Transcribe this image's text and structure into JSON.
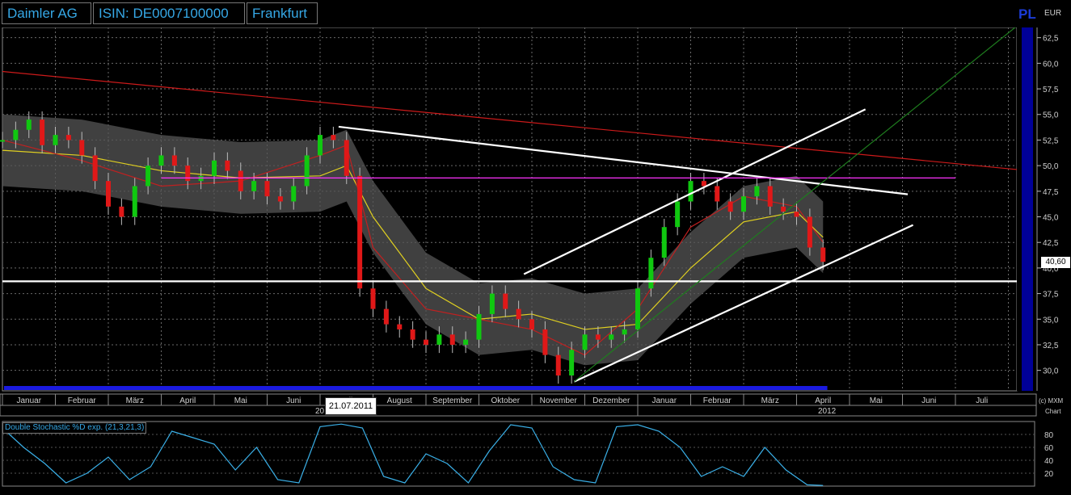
{
  "header": {
    "name": "Daimler AG",
    "isin": "ISIN: DE0007100000",
    "exchange": "Frankfurt",
    "pl_marker": "PL",
    "currency": "EUR"
  },
  "chart_data": [
    {
      "type": "line",
      "title": "Daimler AG",
      "x_months": [
        "Januar",
        "Februar",
        "März",
        "April",
        "Mai",
        "Juni",
        "Juli",
        "August",
        "September",
        "Oktober",
        "November",
        "Dezember",
        "Januar",
        "Februar",
        "März",
        "April",
        "Mai",
        "Juni",
        "Juli"
      ],
      "x_years": [
        "2011",
        "2012"
      ],
      "y_ticks": [
        30.0,
        32.5,
        35.0,
        37.5,
        40.0,
        42.5,
        45.0,
        47.5,
        50.0,
        52.5,
        55.0,
        57.5,
        60.0,
        62.5
      ],
      "ylim": [
        28.0,
        63.5
      ],
      "grid": true,
      "last_price": "40,60",
      "crosshair_date": "21.07.2011",
      "series": [
        {
          "type": "candlestick",
          "x": [
            0,
            0.25,
            0.5,
            0.75,
            1,
            1.25,
            1.5,
            1.75,
            2,
            2.25,
            2.5,
            2.75,
            3,
            3.25,
            3.5,
            3.75,
            4,
            4.25,
            4.5,
            4.75,
            5,
            5.25,
            5.5,
            5.75,
            6,
            6.25,
            6.5,
            6.75,
            7,
            7.25,
            7.5,
            7.75,
            8,
            8.25,
            8.5,
            8.75,
            9,
            9.25,
            9.5,
            9.75,
            10,
            10.25,
            10.5,
            10.75,
            11,
            11.25,
            11.5,
            11.75,
            12,
            12.25,
            12.5,
            12.75,
            13,
            13.25,
            13.5,
            13.75,
            14,
            14.25,
            14.5,
            14.75,
            15,
            15.25,
            15.5
          ],
          "close": [
            52.5,
            53.5,
            54.5,
            52,
            53,
            52.5,
            51,
            48.5,
            46,
            45,
            48,
            50,
            51,
            50,
            48.5,
            49,
            50.5,
            49.5,
            47.5,
            48.5,
            47,
            46.5,
            48,
            51,
            53,
            52.5,
            49,
            38,
            36,
            34.5,
            34,
            33,
            32.5,
            33.5,
            32.5,
            33,
            35.5,
            37.5,
            36,
            35,
            34,
            31.5,
            29.5,
            32,
            33.5,
            33,
            33.5,
            34,
            38,
            41,
            44,
            46.5,
            48.5,
            48,
            46.5,
            45.5,
            47,
            48,
            46,
            45.5,
            45,
            42,
            40.6
          ]
        },
        {
          "name": "",
          "x": [
            0,
            1.5,
            3,
            4.5,
            6,
            6.5,
            7,
            8,
            9,
            10,
            11,
            12,
            13,
            14,
            15,
            15.5
          ],
          "values": [
            51.5,
            51,
            49.5,
            48.8,
            49,
            50,
            45,
            38,
            35,
            35.5,
            34,
            34.5,
            40,
            44.5,
            45.5,
            43
          ]
        },
        {
          "name": "",
          "x": [
            0,
            1.5,
            3,
            4.5,
            6,
            6.5,
            7,
            8,
            9,
            10,
            11,
            12,
            13,
            14,
            15,
            15.5
          ],
          "values": [
            52.5,
            50.5,
            48,
            48.5,
            51,
            52,
            42,
            36,
            35,
            34,
            31.5,
            36,
            44,
            47,
            46,
            42.5
          ]
        }
      ],
      "lines": [
        {
          "name": "",
          "color": "#cc1a1a",
          "from": [
            0,
            59.2
          ],
          "to": [
            19.2,
            49.6
          ]
        },
        {
          "name": "",
          "color": "#ffffff",
          "from": [
            6.35,
            53.8
          ],
          "to": [
            17.1,
            47.2
          ]
        },
        {
          "name": "",
          "color": "#ffffff",
          "from": [
            9.85,
            39.4
          ],
          "to": [
            16.3,
            55.5
          ]
        },
        {
          "name": "",
          "color": "#ffffff",
          "from": [
            10.8,
            28.9
          ],
          "to": [
            17.2,
            44.2
          ]
        },
        {
          "name": "",
          "color": "#ff33ff",
          "from": [
            3.0,
            48.8
          ],
          "to": [
            18.0,
            48.8
          ]
        },
        {
          "name": "",
          "color": "#ffffff",
          "from": [
            0,
            38.7
          ],
          "to": [
            19.4,
            38.7
          ]
        },
        {
          "name": "",
          "color": "#1e7d1e",
          "from": [
            10.8,
            28.9
          ],
          "to": [
            19.2,
            63.8
          ]
        }
      ]
    },
    {
      "type": "line",
      "title": "Double Stochastic %D exp. (21,3,21,3)",
      "y_ticks": [
        20,
        40,
        60,
        80
      ],
      "ylim": [
        0,
        100
      ],
      "series": [
        {
          "name": "",
          "x": [
            0,
            0.4,
            0.8,
            1.2,
            1.6,
            2,
            2.4,
            2.8,
            3.2,
            3.6,
            4,
            4.4,
            4.8,
            5.2,
            5.6,
            6,
            6.4,
            6.8,
            7.2,
            7.6,
            8,
            8.4,
            8.8,
            9.2,
            9.6,
            10,
            10.4,
            10.8,
            11.2,
            11.6,
            12,
            12.4,
            12.8,
            13.2,
            13.6,
            14,
            14.4,
            14.8,
            15.2,
            15.5
          ],
          "values": [
            90,
            60,
            35,
            5,
            20,
            45,
            10,
            30,
            85,
            75,
            65,
            25,
            60,
            10,
            5,
            92,
            96,
            90,
            15,
            5,
            50,
            35,
            5,
            55,
            95,
            90,
            30,
            10,
            5,
            92,
            95,
            85,
            60,
            15,
            30,
            15,
            60,
            25,
            2,
            1
          ]
        }
      ]
    }
  ],
  "axis_bar": {
    "year_left": "201",
    "year_right": "2012",
    "copyright": "(c) MXM",
    "sub": "Chart"
  }
}
